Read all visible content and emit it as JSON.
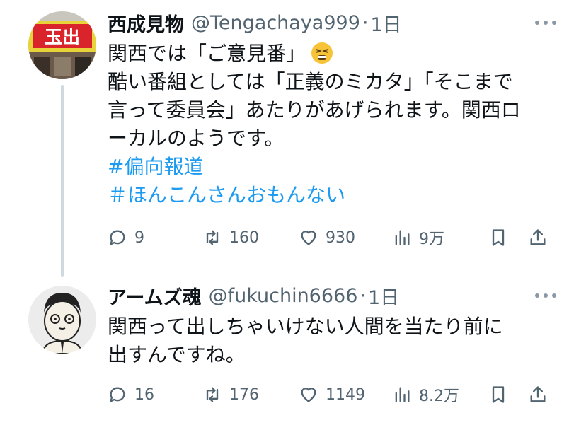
{
  "posts": [
    {
      "name": "西成見物",
      "handle": "@Tengachaya999",
      "separator": "·",
      "time": "1日",
      "avatar_sign_text": "玉出",
      "lines": [
        "関西では「ご意見番」",
        "酷い番組としては「正義のミカタ」「そこまで",
        "言って委員会」あたりがあげられます。関西ロ",
        "ーカルのようです。"
      ],
      "emoji": "tired-face-emoji",
      "hashtags": [
        "#偏向報道",
        "＃ほんこんさんおもんない"
      ],
      "counts": {
        "reply": "9",
        "retweet": "160",
        "like": "930",
        "views": "9万"
      }
    },
    {
      "name": "アームズ魂",
      "handle": "@fukuchin6666",
      "separator": "·",
      "time": "1日",
      "lines": [
        "関西って出しちゃいけない人間を当たり前に",
        "出すんですね。"
      ],
      "counts": {
        "reply": "16",
        "retweet": "176",
        "like": "1149",
        "views": "8.2万"
      }
    }
  ],
  "colors": {
    "text": "#0f1419",
    "secondary": "#536471",
    "link": "#1d9bf0",
    "thread_line": "#cfd9de"
  },
  "icons": {
    "reply": "reply-icon",
    "retweet": "retweet-icon",
    "like": "heart-icon",
    "views": "views-chart-icon",
    "bookmark": "bookmark-icon",
    "share": "share-icon",
    "more": "more-dots-icon"
  }
}
